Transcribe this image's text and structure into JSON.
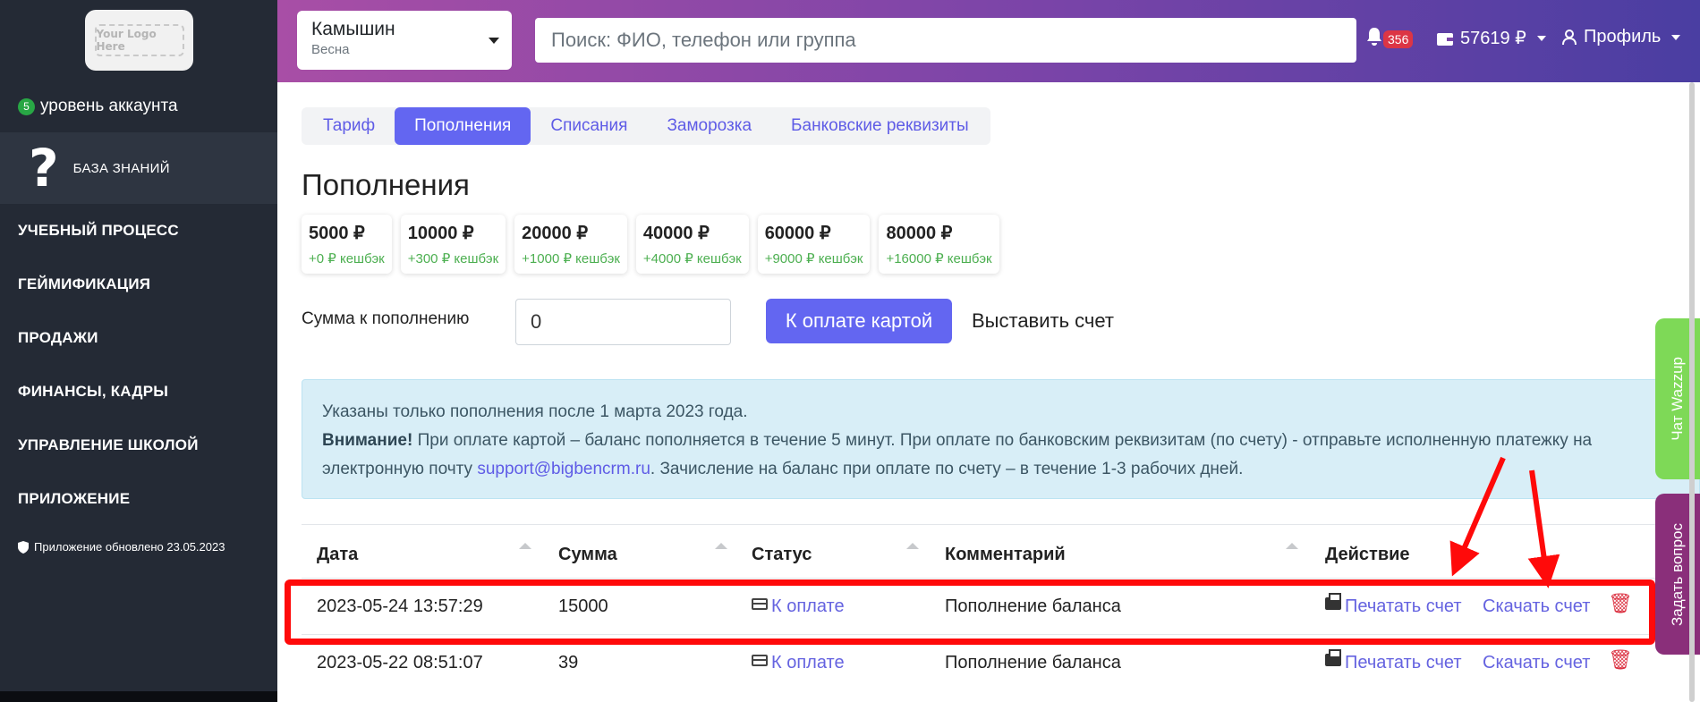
{
  "sidebar": {
    "logo_text": "Your Logo Here",
    "account_level": "5",
    "account_level_label": "уровень аккаунта",
    "knowledge_base": "БАЗА ЗНАНИЙ",
    "menu": [
      "УЧЕБНЫЙ ПРОЦЕСС",
      "ГЕЙМИФИКАЦИЯ",
      "ПРОДАЖИ",
      "ФИНАНСЫ, КАДРЫ",
      "УПРАВЛЕНИЕ ШКОЛОЙ",
      "ПРИЛОЖЕНИЕ"
    ],
    "updated": "Приложение обновлено 23.05.2023"
  },
  "header": {
    "city": "Камышин",
    "season": "Весна",
    "search_placeholder": "Поиск: ФИО, телефон или группа",
    "notifications": "356",
    "balance": "57619 ₽",
    "profile": "Профиль"
  },
  "tabs": [
    "Тариф",
    "Пополнения",
    "Списания",
    "Заморозка",
    "Банковские реквизиты"
  ],
  "page_title": "Пополнения",
  "packages": [
    {
      "amount": "5000 ₽",
      "cashback": "+0 ₽ кешбэк"
    },
    {
      "amount": "10000 ₽",
      "cashback": "+300 ₽ кешбэк"
    },
    {
      "amount": "20000 ₽",
      "cashback": "+1000 ₽ кешбэк"
    },
    {
      "amount": "40000 ₽",
      "cashback": "+4000 ₽ кешбэк"
    },
    {
      "amount": "60000 ₽",
      "cashback": "+9000 ₽ кешбэк"
    },
    {
      "amount": "80000 ₽",
      "cashback": "+16000 ₽ кешбэк"
    }
  ],
  "topup": {
    "label": "Сумма к пополнению",
    "value": "0",
    "pay_card": "К оплате картой",
    "invoice": "Выставить счет"
  },
  "alert": {
    "line1": "Указаны только пополнения после 1 марта 2023 года.",
    "attention": "Внимание!",
    "line2": " При оплате картой – баланс пополняется в течение 5 минут. При оплате по банковским реквизитам (по счету) - отправьте исполненную платежку на",
    "line3a": "электронную почту ",
    "email": "support@bigbencrm.ru",
    "line3b": ". Зачисление на баланс при оплате по счету – в течение 1-3 рабочих дней."
  },
  "table": {
    "headers": [
      "Дата",
      "Сумма",
      "Статус",
      "Комментарий",
      "Действие"
    ],
    "rows": [
      {
        "date": "2023-05-24 13:57:29",
        "sum": "15000",
        "status": "К оплате",
        "comment": "Пополнение баланса",
        "print": "Печатать счет",
        "download": "Скачать счет"
      },
      {
        "date": "2023-05-22 08:51:07",
        "sum": "39",
        "status": "К оплате",
        "comment": "Пополнение баланса",
        "print": "Печатать счет",
        "download": "Скачать счет"
      }
    ]
  },
  "side_tabs": {
    "wazzup": "Чат Wazzup",
    "ask": "Задать вопрос"
  },
  "colors": {
    "accent": "#6366f1",
    "sidebar": "#242a35",
    "highlight": "#ff0a0a",
    "wazzup": "#7ed957",
    "ask": "#8a2f7a"
  }
}
